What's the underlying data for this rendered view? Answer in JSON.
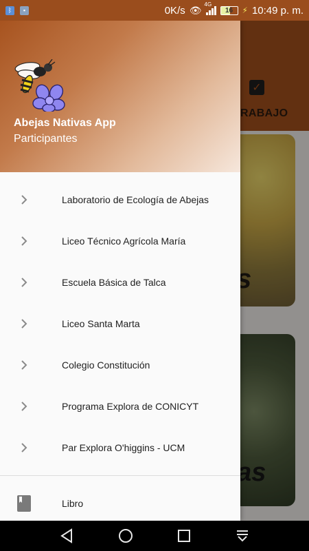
{
  "status_bar": {
    "speed": "0K/s",
    "network": "4G",
    "battery": "16",
    "time": "10:49 p. m."
  },
  "background": {
    "tab_label": "RABAJO",
    "card1_text": "s",
    "card2_text": "cas"
  },
  "drawer": {
    "title": "Abejas Nativas App",
    "subtitle": "Participantes",
    "items": [
      {
        "label": "Laboratorio de Ecología de Abejas"
      },
      {
        "label": "Liceo Técnico Agrícola María"
      },
      {
        "label": "Escuela Básica de Talca"
      },
      {
        "label": "Liceo Santa Marta"
      },
      {
        "label": "Colegio Constitución"
      },
      {
        "label": "Programa Explora de CONICYT"
      },
      {
        "label": "Par Explora O'higgins - UCM"
      }
    ],
    "footer_item": {
      "label": "Libro",
      "icon": "book-icon"
    }
  },
  "colors": {
    "primary": "#9e4e1c",
    "drawer_bg": "#fafafa",
    "text": "#212121",
    "icon_gray": "#8a8a8a"
  },
  "icons": [
    "bluetooth-notification-icon",
    "image-notification-icon",
    "eye-icon",
    "signal-icon",
    "battery-icon",
    "chevron-right-icon",
    "book-icon",
    "back-icon",
    "home-icon",
    "recents-icon",
    "notifications-pull-icon"
  ]
}
